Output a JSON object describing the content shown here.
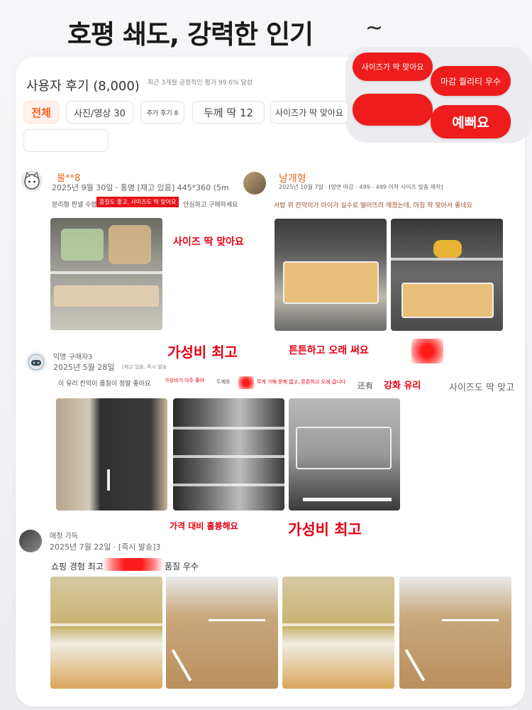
{
  "header": {
    "headline": "호평 쇄도, 강력한 인기",
    "tilde": "~"
  },
  "review_header": {
    "title": "사용자 후기 (8,000)",
    "subtitle": "최근 3개월 긍정적인 평가 99.6% 달성"
  },
  "filters": [
    {
      "label": "전체"
    },
    {
      "label": "사진/영상 30"
    },
    {
      "label": "추가 후기 8"
    },
    {
      "label": "두께 딱 12"
    },
    {
      "label": "사이즈가 딱 맞아요"
    }
  ],
  "bubbles": {
    "b1": "사이즈가 딱 맞아요",
    "b2": "마감 퀄리티 우수",
    "b3": "예뻐요"
  },
  "reviews": {
    "r1": {
      "name": "물**8",
      "meta": "2025년 9월 30일 · 통명 [재고 있음] 445*360 (5m",
      "text_left": "분리형 판넬 수령",
      "tag": "품질도 좋고, 사이즈도 딱 맞아요",
      "text_right": "안심하고 구매하세요",
      "annotation": "사이즈 딱 맞아요"
    },
    "r2": {
      "name": "날개형",
      "meta": "2025년 10월 7일 · [양면 마감 - 499 - 499 이하 사이즈 맞춤 제작]",
      "text": "서랍 위 칸막이가 아이가 실수로 떨어뜨려 깨졌는데, 마침 딱 맞아서 좋네요",
      "annotation": "튼튼하고 오래 써요"
    },
    "r3": {
      "name": "익명 구매자3",
      "meta": "2025년 5월 28일",
      "meta_small": "[재고 있음, 즉시 발송",
      "text": "이 유리 칸막이 품질이 정말 좋아요",
      "text_mid": "가성비가 아주 좋아",
      "text_mid2": "두께와",
      "text_long": "무게 가해 문제 없고, 튼튼하고 오래 갑니다",
      "text_mix": "还有",
      "annotation_top": "가성비 최고",
      "annotation_right": "강화 유리",
      "annotation_gray": "사이즈도 딱 맞고",
      "annotation_bottom": "가격 대비 훌륭해요"
    },
    "r4": {
      "name": "애정 가득",
      "meta": "2025년 7월 22일 · [즉시 발송]3",
      "text_left": "쇼핑 경험 최고",
      "text_right": "품질 우수",
      "annotation": "가성비 최고"
    }
  },
  "colors": {
    "accent": "#ff5a1f",
    "red": "#e60012",
    "bubble": "#ee1c1c"
  }
}
